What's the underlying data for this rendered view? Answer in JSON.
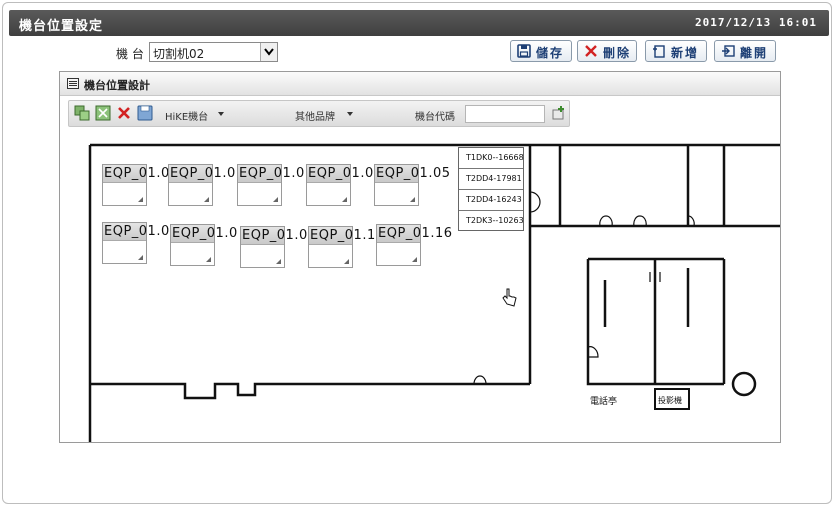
{
  "header": {
    "title": "機台位置設定",
    "datetime": "2017/12/13 16:01"
  },
  "machine": {
    "label": "機 台",
    "selected": "切割机02"
  },
  "buttons": {
    "save": "儲存",
    "delete": "刪除",
    "new": "新增",
    "exit": "離開"
  },
  "panel": {
    "title": "機台位置設計"
  },
  "toolbar": {
    "dropdown1": "HiKE機台",
    "dropdown2": "其他品牌",
    "code_label": "機台代碼",
    "code_value": ""
  },
  "equipment": {
    "row1": [
      "EQP_01.0",
      "EQP_01.0",
      "EQP_01.0",
      "EQP_01.0",
      "EQP_01.05"
    ],
    "row2": [
      "EQP_01.0",
      "EQP_01.0",
      "EQP_01.0",
      "EQP_01.1",
      "EQP_01.16"
    ]
  },
  "code_list": [
    "T1DK0--16668",
    "T2DD4-17981",
    "T2DD4-16243",
    "T2DK3--10263"
  ],
  "floorplan": {
    "room1": "電話亭",
    "room2": "投影機"
  },
  "colors": {
    "titlebar": "#4a4a4a",
    "button_text": "#1d3f75",
    "delete_icon": "#d22222"
  }
}
